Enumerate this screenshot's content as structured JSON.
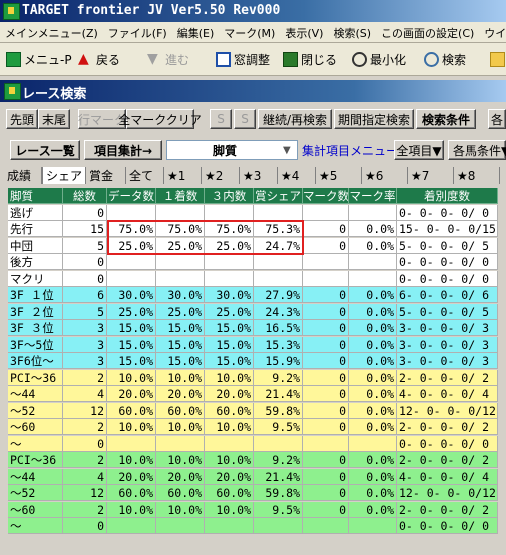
{
  "window": {
    "title": "TARGET frontier JV  Ver5.50  Rev000"
  },
  "menu": [
    "メインメニュー(Z)",
    "ファイル(F)",
    "編集(E)",
    "マーク(M)",
    "表示(V)",
    "検索(S)",
    "この画面の設定(C)",
    "ウインドウ(W)"
  ],
  "toolbar": {
    "menu_p": "メニュ-P",
    "back": "戻る",
    "forward": "進む",
    "window_adjust": "窓調整",
    "close": "閉じる",
    "minimize": "最小化",
    "search": "検索"
  },
  "inner": {
    "title": "レース検索",
    "buttons": {
      "first": "先頭",
      "last": "末尾",
      "row_mark": "行マーク",
      "clear_all_marks": "全マーククリア",
      "s1": "S",
      "s2": "S",
      "continue_search": "継続/再検索",
      "period_search": "期間指定検索",
      "search_conditions": "検索条件",
      "more": "各"
    },
    "row2": {
      "race_list": "レース一覧",
      "item_stats": "項目集計→",
      "item_select_value": "脚質",
      "stats_menu": "集計項目メニュー",
      "all_items": "全項目▼",
      "horse_conditions": "各馬条件▼"
    }
  },
  "tabs": [
    "成績",
    "シェア",
    "賞金",
    "全て",
    "★1",
    "★2",
    "★3",
    "★4",
    "★5",
    "★6",
    "★7",
    "★8"
  ],
  "active_tab": "シェア",
  "table": {
    "headers": [
      "脚質",
      "総数",
      "データ数",
      "１着数",
      "３内数",
      "賞シェア",
      "マーク数",
      "マーク率",
      "着別度数"
    ],
    "rows": [
      {
        "label": "逃げ",
        "total": "0",
        "data": "",
        "first": "",
        "top3": "",
        "share": "",
        "marks": "",
        "rate": "",
        "dist": "0- 0- 0- 0/ 0",
        "bg": "#ffffff"
      },
      {
        "label": "先行",
        "total": "15",
        "data": "75.0%",
        "first": "75.0%",
        "top3": "75.0%",
        "share": "75.3%",
        "marks": "0",
        "rate": "0.0%",
        "dist": "15- 0- 0- 0/15",
        "bg": "#ffffff"
      },
      {
        "label": "中団",
        "total": "5",
        "data": "25.0%",
        "first": "25.0%",
        "top3": "25.0%",
        "share": "24.7%",
        "marks": "0",
        "rate": "0.0%",
        "dist": "5- 0- 0- 0/ 5",
        "bg": "#ffffff"
      },
      {
        "label": "後方",
        "total": "0",
        "data": "",
        "first": "",
        "top3": "",
        "share": "",
        "marks": "",
        "rate": "",
        "dist": "0- 0- 0- 0/ 0",
        "bg": "#ffffff"
      },
      {
        "label": "マクリ",
        "total": "0",
        "data": "",
        "first": "",
        "top3": "",
        "share": "",
        "marks": "",
        "rate": "",
        "dist": "0- 0- 0- 0/ 0",
        "bg": "#ffffff"
      },
      {
        "label": "3F １位",
        "total": "6",
        "data": "30.0%",
        "first": "30.0%",
        "top3": "30.0%",
        "share": "27.9%",
        "marks": "0",
        "rate": "0.0%",
        "dist": "6- 0- 0- 0/ 6",
        "bg": "#87f0f5"
      },
      {
        "label": "3F ２位",
        "total": "5",
        "data": "25.0%",
        "first": "25.0%",
        "top3": "25.0%",
        "share": "24.3%",
        "marks": "0",
        "rate": "0.0%",
        "dist": "5- 0- 0- 0/ 5",
        "bg": "#87f0f5"
      },
      {
        "label": "3F ３位",
        "total": "3",
        "data": "15.0%",
        "first": "15.0%",
        "top3": "15.0%",
        "share": "16.5%",
        "marks": "0",
        "rate": "0.0%",
        "dist": "3- 0- 0- 0/ 3",
        "bg": "#87f0f5"
      },
      {
        "label": "3F～5位",
        "total": "3",
        "data": "15.0%",
        "first": "15.0%",
        "top3": "15.0%",
        "share": "15.3%",
        "marks": "0",
        "rate": "0.0%",
        "dist": "3- 0- 0- 0/ 3",
        "bg": "#87f0f5"
      },
      {
        "label": "3F6位～",
        "total": "3",
        "data": "15.0%",
        "first": "15.0%",
        "top3": "15.0%",
        "share": "15.9%",
        "marks": "0",
        "rate": "0.0%",
        "dist": "3- 0- 0- 0/ 3",
        "bg": "#87f0f5"
      },
      {
        "label": "PCI～36",
        "total": "2",
        "data": "10.0%",
        "first": "10.0%",
        "top3": "10.0%",
        "share": "9.2%",
        "marks": "0",
        "rate": "0.0%",
        "dist": "2- 0- 0- 0/ 2",
        "bg": "#fff79a"
      },
      {
        "label": "～44",
        "total": "4",
        "data": "20.0%",
        "first": "20.0%",
        "top3": "20.0%",
        "share": "21.4%",
        "marks": "0",
        "rate": "0.0%",
        "dist": "4- 0- 0- 0/ 4",
        "bg": "#fff79a"
      },
      {
        "label": "～52",
        "total": "12",
        "data": "60.0%",
        "first": "60.0%",
        "top3": "60.0%",
        "share": "59.8%",
        "marks": "0",
        "rate": "0.0%",
        "dist": "12- 0- 0- 0/12",
        "bg": "#fff79a"
      },
      {
        "label": "～60",
        "total": "2",
        "data": "10.0%",
        "first": "10.0%",
        "top3": "10.0%",
        "share": "9.5%",
        "marks": "0",
        "rate": "0.0%",
        "dist": "2- 0- 0- 0/ 2",
        "bg": "#fff79a"
      },
      {
        "label": "～",
        "total": "0",
        "data": "",
        "first": "",
        "top3": "",
        "share": "",
        "marks": "",
        "rate": "",
        "dist": "0- 0- 0- 0/ 0",
        "bg": "#fff79a"
      },
      {
        "label": "PCI～36",
        "total": "2",
        "data": "10.0%",
        "first": "10.0%",
        "top3": "10.0%",
        "share": "9.2%",
        "marks": "0",
        "rate": "0.0%",
        "dist": "2- 0- 0- 0/ 2",
        "bg": "#8ef08e"
      },
      {
        "label": "～44",
        "total": "4",
        "data": "20.0%",
        "first": "20.0%",
        "top3": "20.0%",
        "share": "21.4%",
        "marks": "0",
        "rate": "0.0%",
        "dist": "4- 0- 0- 0/ 4",
        "bg": "#8ef08e"
      },
      {
        "label": "～52",
        "total": "12",
        "data": "60.0%",
        "first": "60.0%",
        "top3": "60.0%",
        "share": "59.8%",
        "marks": "0",
        "rate": "0.0%",
        "dist": "12- 0- 0- 0/12",
        "bg": "#8ef08e"
      },
      {
        "label": "～60",
        "total": "2",
        "data": "10.0%",
        "first": "10.0%",
        "top3": "10.0%",
        "share": "9.5%",
        "marks": "0",
        "rate": "0.0%",
        "dist": "2- 0- 0- 0/ 2",
        "bg": "#8ef08e"
      },
      {
        "label": "～",
        "total": "0",
        "data": "",
        "first": "",
        "top3": "",
        "share": "",
        "marks": "",
        "rate": "",
        "dist": "0- 0- 0- 0/ 0",
        "bg": "#8ef08e"
      }
    ]
  },
  "colors": {
    "header_bg": "#1e7a4a",
    "highlight_border": "#e02020",
    "title_bar": "#0a246a"
  }
}
